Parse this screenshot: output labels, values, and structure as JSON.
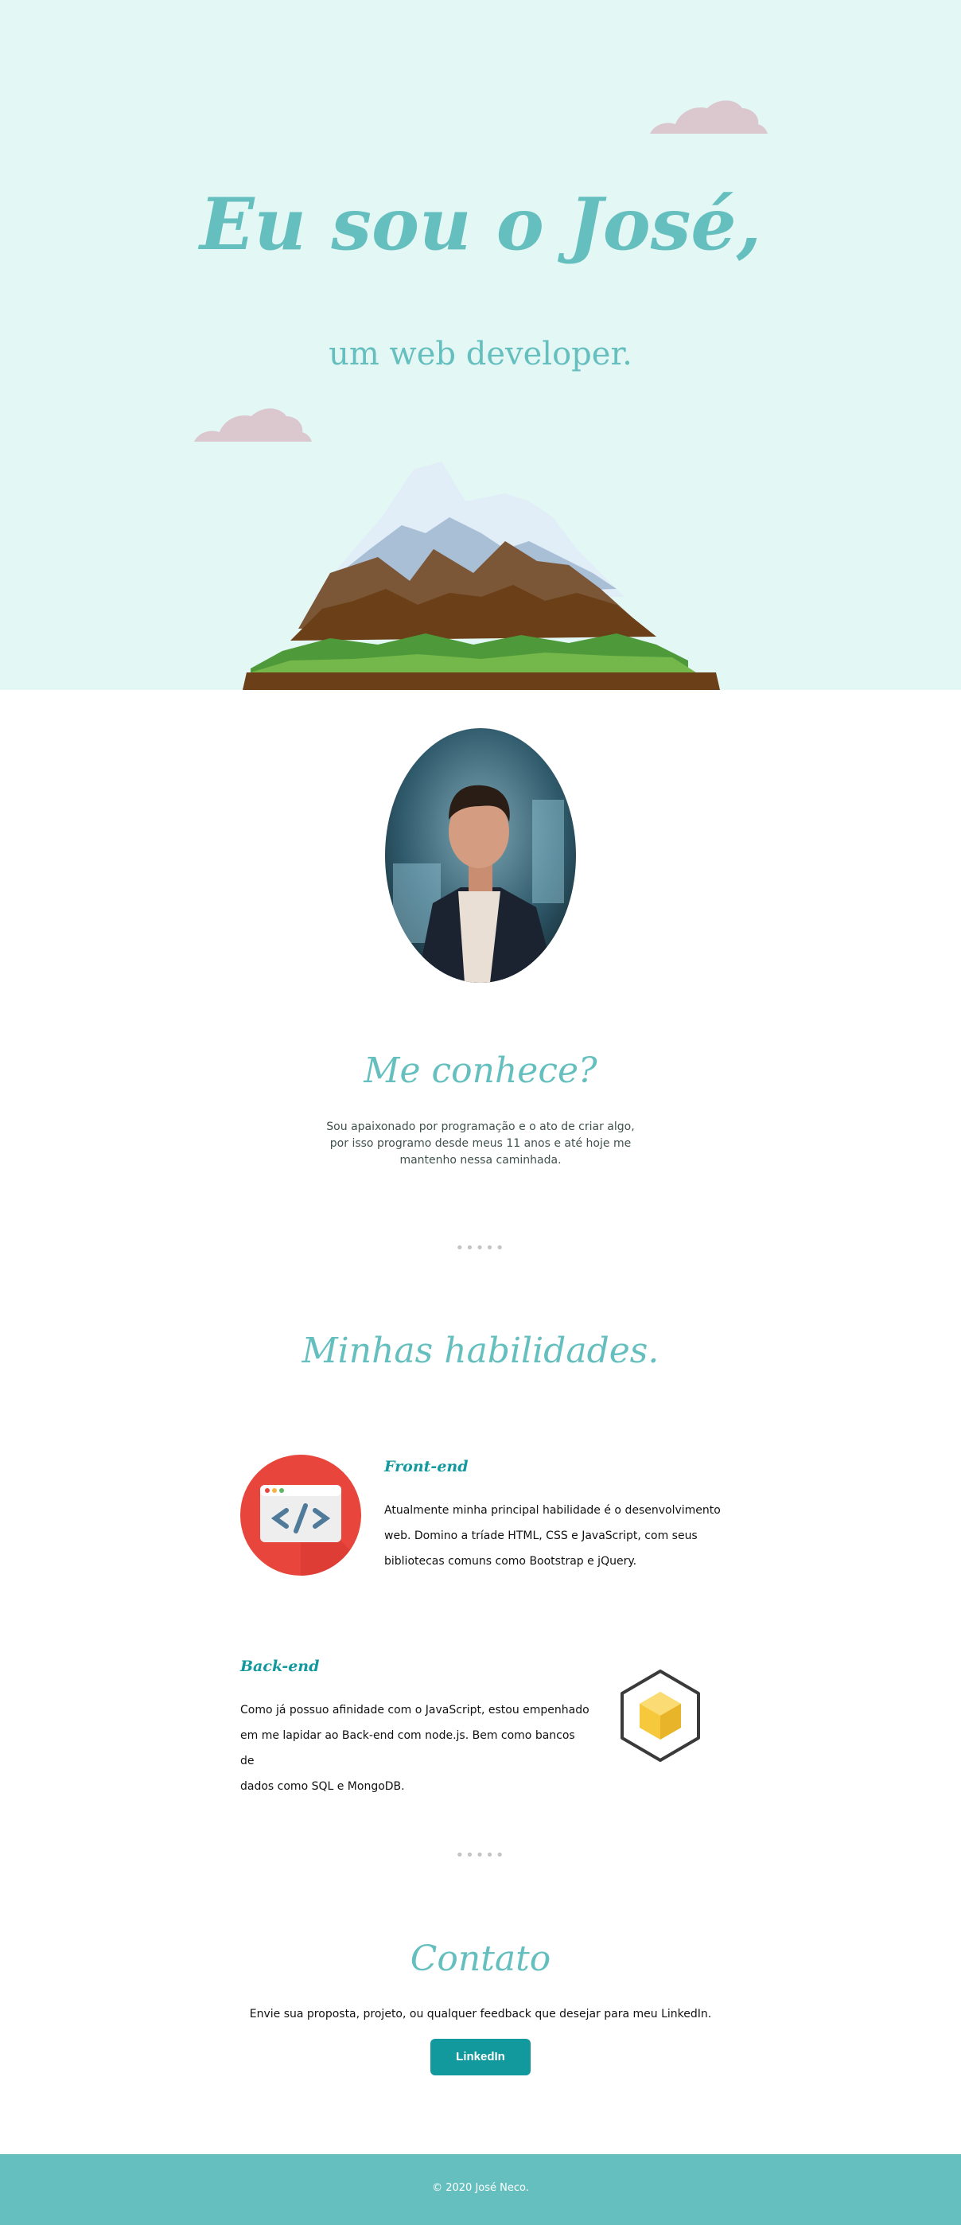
{
  "hero": {
    "title": "Eu sou o José,",
    "subtitle": "um web developer."
  },
  "about": {
    "title": "Me conhece?",
    "lines": [
      "Sou apaixonado por programação e o ato de criar algo,",
      "por isso programo desde meus 11 anos e até hoje me",
      "mantenho nessa caminhada."
    ]
  },
  "divider": "•••••",
  "skills": {
    "title": "Minhas habilidades.",
    "frontend": {
      "title": "Front-end",
      "lines": [
        "Atualmente minha principal habilidade é o desenvolvimento",
        "web. Domino a tríade HTML, CSS e JavaScript, com seus",
        "bibliotecas comuns como Bootstrap e jQuery."
      ]
    },
    "backend": {
      "title": "Back-end",
      "lines": [
        "Como já possuo afinidade com o JavaScript, estou empenhado",
        "em me lapidar ao Back-end com node.js. Bem como bancos de",
        "dados como SQL e MongoDB."
      ]
    }
  },
  "contact": {
    "title": "Contato",
    "text": "Envie sua proposta, projeto, ou qualquer feedback que desejar para meu LinkedIn.",
    "button": "LinkedIn"
  },
  "footer": {
    "text": "© 2020 José Neco."
  },
  "colors": {
    "hero_bg": "#e3f7f4",
    "accent": "#66bfbf",
    "button": "#11999e",
    "cloud": "#dbc8ce"
  },
  "icons": [
    "cloud-icon",
    "mountain-illustration",
    "code-window-icon",
    "cube-icon"
  ]
}
